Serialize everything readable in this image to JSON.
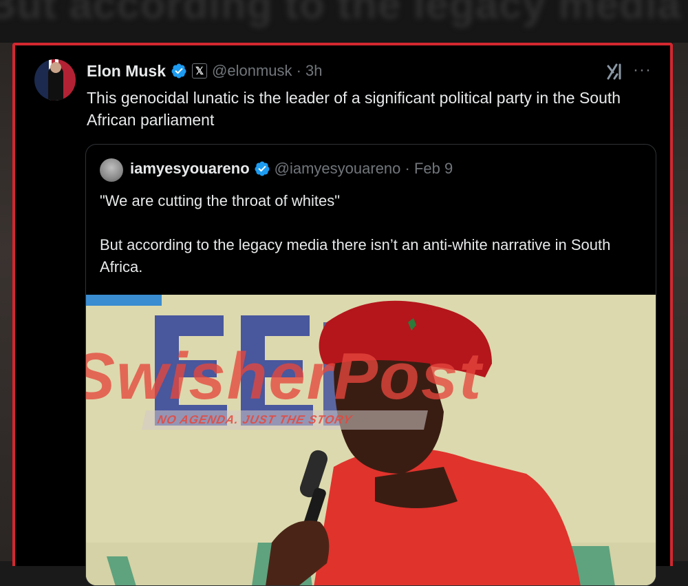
{
  "background": {
    "caption": "But according to the legacy media there isn't an anti-white"
  },
  "tweet": {
    "author_name": "Elon Musk",
    "handle_time": "@elonmusk · 3h",
    "x_badge": "𝕏",
    "more": "···",
    "text": "This genocidal lunatic is the leader of a significant political party in the South African parliament"
  },
  "quoted": {
    "author_name": "iamyesyouareno",
    "handle_time": "@iamyesyouareno · Feb 9",
    "line1": "\"We are cutting the throat of whites\"",
    "line2": "But according to the legacy media there isn’t an anti-white narrative in South Africa."
  },
  "watermark": {
    "brand": "SwisherPost",
    "tagline": "NO AGENDA. JUST THE STORY"
  },
  "colors": {
    "frame": "#d3272f",
    "verified": "#1d9bf0",
    "muted": "#71767b",
    "text": "#e7e9ea"
  },
  "icons": [
    "verified-badge-icon",
    "x-affiliate-badge-icon",
    "grok-icon",
    "more-icon"
  ]
}
